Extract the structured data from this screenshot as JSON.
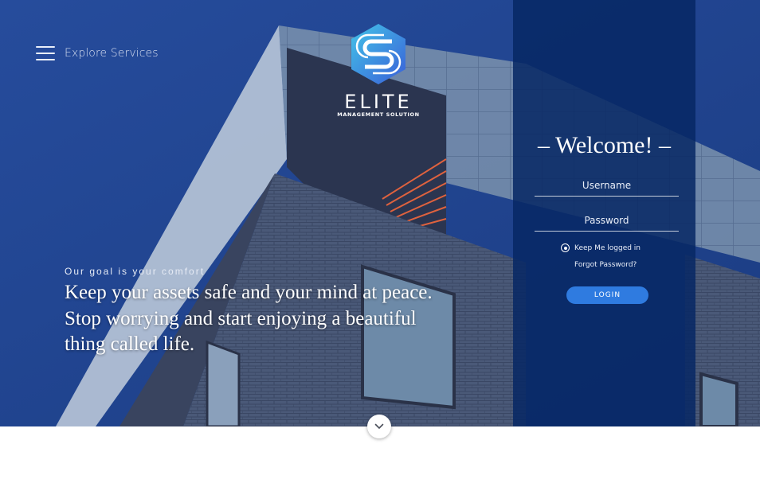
{
  "nav": {
    "menu_icon": "hamburger-icon",
    "label": "Explore Services"
  },
  "brand": {
    "logo_icon": "hexagon-s-logo",
    "name": "ELITE",
    "subtitle": "MANAGEMENT SOLUTION"
  },
  "hero": {
    "tagline": "Our goal is your comfort",
    "headline": "Keep your assets safe and your mind at peace. Stop worrying and start enjoying a beautiful thing called life."
  },
  "login": {
    "title": "– Welcome! –",
    "username_placeholder": "Username",
    "password_placeholder": "Password",
    "remember_label": "Keep Me logged in",
    "remember_checked": true,
    "forgot_label": "Forgot Password?",
    "button_label": "LOGIN"
  },
  "scroll": {
    "icon": "chevron-down-icon"
  },
  "colors": {
    "panel": "#072864",
    "accent": "#2f7be0",
    "logo_blue": "#3a6fd8",
    "logo_cyan": "#43c4e8"
  }
}
